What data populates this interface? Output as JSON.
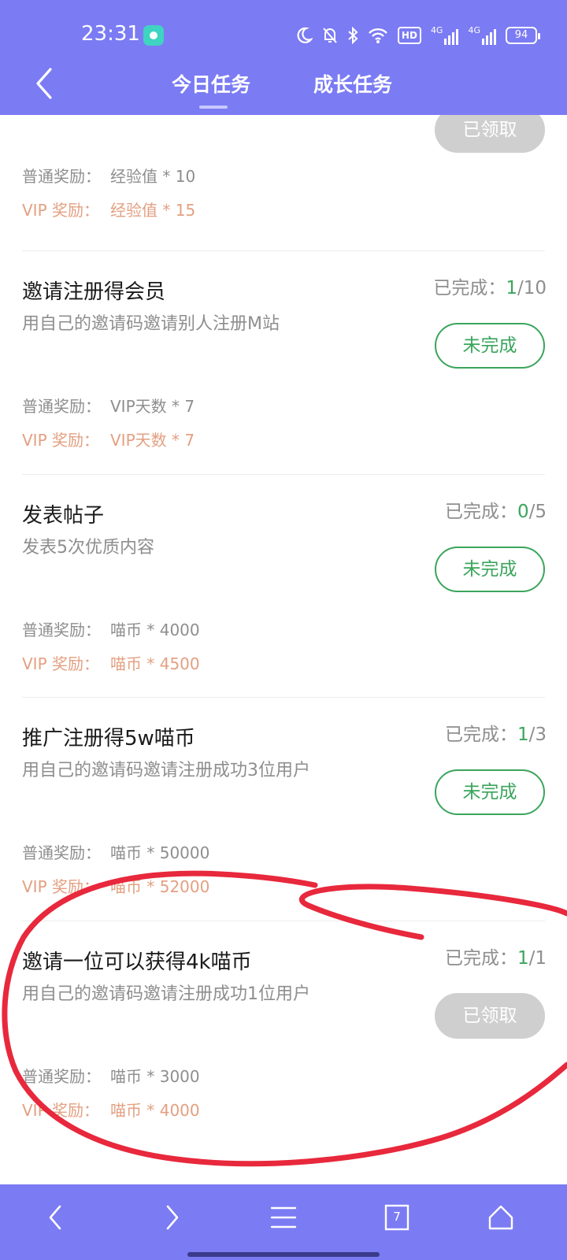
{
  "status": {
    "time": "23:31",
    "icons": [
      "moon-icon",
      "bell-off-icon",
      "bluetooth-icon",
      "wifi-icon",
      "hd-icon",
      "signal-4g-icon",
      "signal-4g-icon"
    ],
    "hd_label": "HD",
    "net1": "4G",
    "net2": "4G",
    "battery": "94"
  },
  "nav": {
    "tabs": [
      {
        "label": "今日任务",
        "active": true
      },
      {
        "label": "成长任务",
        "active": false
      }
    ]
  },
  "tasks": [
    {
      "title": "",
      "desc": "",
      "progress_label": "",
      "button": "已领取",
      "button_state": "claimed",
      "normal_label": "普通奖励：",
      "normal_value": "经验值 * 10",
      "vip_label": "VIP 奖励：",
      "vip_value": "经验值 * 15"
    },
    {
      "title": "邀请注册得会员",
      "desc": "用自己的邀请码邀请别人注册M站",
      "progress_label": "已完成：",
      "progress_done": "1",
      "progress_total": "/10",
      "button": "未完成",
      "button_state": "incomplete",
      "normal_label": "普通奖励：",
      "normal_value": "VIP天数 * 7",
      "vip_label": "VIP 奖励：",
      "vip_value": "VIP天数 * 7"
    },
    {
      "title": "发表帖子",
      "desc": "发表5次优质内容",
      "progress_label": "已完成：",
      "progress_done": "0",
      "progress_total": "/5",
      "button": "未完成",
      "button_state": "incomplete",
      "normal_label": "普通奖励：",
      "normal_value": "喵币 * 4000",
      "vip_label": "VIP 奖励：",
      "vip_value": "喵币 * 4500"
    },
    {
      "title": "推广注册得5w喵币",
      "desc": "用自己的邀请码邀请注册成功3位用户",
      "progress_label": "已完成：",
      "progress_done": "1",
      "progress_total": "/3",
      "button": "未完成",
      "button_state": "incomplete",
      "normal_label": "普通奖励：",
      "normal_value": "喵币 * 50000",
      "vip_label": "VIP 奖励：",
      "vip_value": "喵币 * 52000"
    },
    {
      "title": "邀请一位可以获得4k喵币",
      "desc": "用自己的邀请码邀请注册成功1位用户",
      "progress_label": "已完成：",
      "progress_done": "1",
      "progress_total": "/1",
      "button": "已领取",
      "button_state": "claimed",
      "normal_label": "普通奖励：",
      "normal_value": "喵币 * 3000",
      "vip_label": "VIP 奖励：",
      "vip_value": "喵币 * 4000"
    }
  ],
  "bottom_bar": {
    "items": [
      "back-icon",
      "forward-icon",
      "menu-icon",
      "tabs-icon",
      "home-icon"
    ],
    "tab_count": "7"
  },
  "colors": {
    "header": "#7b7bf3",
    "success": "#3aa55c",
    "vip": "#e3a082",
    "annotation": "#e8283c"
  }
}
